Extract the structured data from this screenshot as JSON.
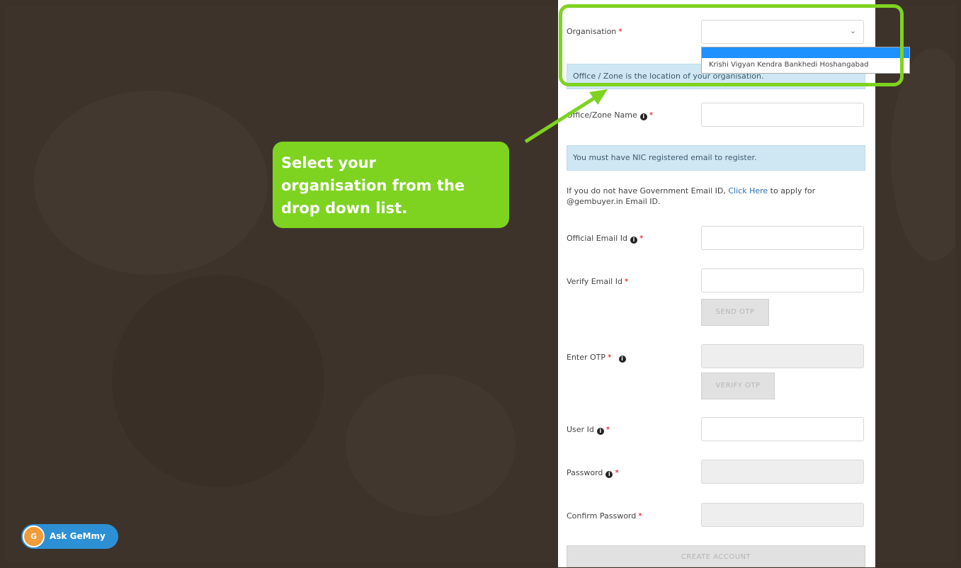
{
  "callout": {
    "line1": "Select your",
    "line2": "organisation from the",
    "line3": "drop down list."
  },
  "form": {
    "organisation_label": "Organisation",
    "required_mark": "*",
    "info_mark": "i",
    "select_chevron": "⌄",
    "dropdown_option": "Krishi Vigyan Kendra Bankhedi Hoshangabad",
    "office_info": "Office / Zone is the location of your organisation.",
    "office_zone_label": "Office/Zone Name",
    "nic_alert": "You must have NIC registered email to register.",
    "gov_email_text_1": "If you do not have Government Email ID,",
    "click_here": "Click Here",
    "gov_email_text_2": "to apply for",
    "gov_email_text_3": "@gembuyer.in Email ID.",
    "official_email_label": "Official Email Id",
    "verify_email_label": "Verify Email Id",
    "send_otp": "SEND OTP",
    "enter_otp_label": "Enter OTP",
    "verify_otp": "VERIFY OTP",
    "user_id_label": "User Id",
    "password_label": "Password",
    "confirm_password_label": "Confirm Password",
    "create_account": "CREATE ACCOUNT"
  },
  "assistant": {
    "label": "Ask GeMmy",
    "avatar_text": "G"
  },
  "colors": {
    "highlight": "#7ed321",
    "background": "#3d332b",
    "selection": "#1e90ff",
    "assistant": "#2d90d4"
  }
}
